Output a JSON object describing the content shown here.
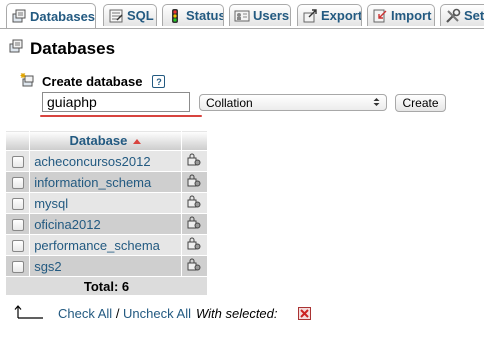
{
  "tabs": [
    {
      "label": "Databases",
      "icon": "databases-icon",
      "active": true
    },
    {
      "label": "SQL",
      "icon": "sql-icon"
    },
    {
      "label": "Status",
      "icon": "status-icon"
    },
    {
      "label": "Users",
      "icon": "users-icon"
    },
    {
      "label": "Export",
      "icon": "export-icon"
    },
    {
      "label": "Import",
      "icon": "import-icon"
    },
    {
      "label": "Set",
      "icon": "settings-icon"
    }
  ],
  "page": {
    "title": "Databases"
  },
  "create": {
    "heading": "Create database",
    "name_value": "guiaphp",
    "collation_placeholder": "Collation",
    "create_label": "Create"
  },
  "table": {
    "header": "Database",
    "rows": [
      {
        "name": "acheconcursos2012"
      },
      {
        "name": "information_schema"
      },
      {
        "name": "mysql"
      },
      {
        "name": "oficina2012"
      },
      {
        "name": "performance_schema"
      },
      {
        "name": "sgs2"
      }
    ],
    "total": "Total: 6"
  },
  "footer": {
    "check_all": "Check All",
    "separator": " / ",
    "uncheck_all": "Uncheck All",
    "with_selected": "With selected:"
  },
  "colors": {
    "link": "#235a81",
    "accent_red": "#d8443f",
    "row_odd": "#e6e6e6",
    "row_even": "#cfcfcf"
  }
}
